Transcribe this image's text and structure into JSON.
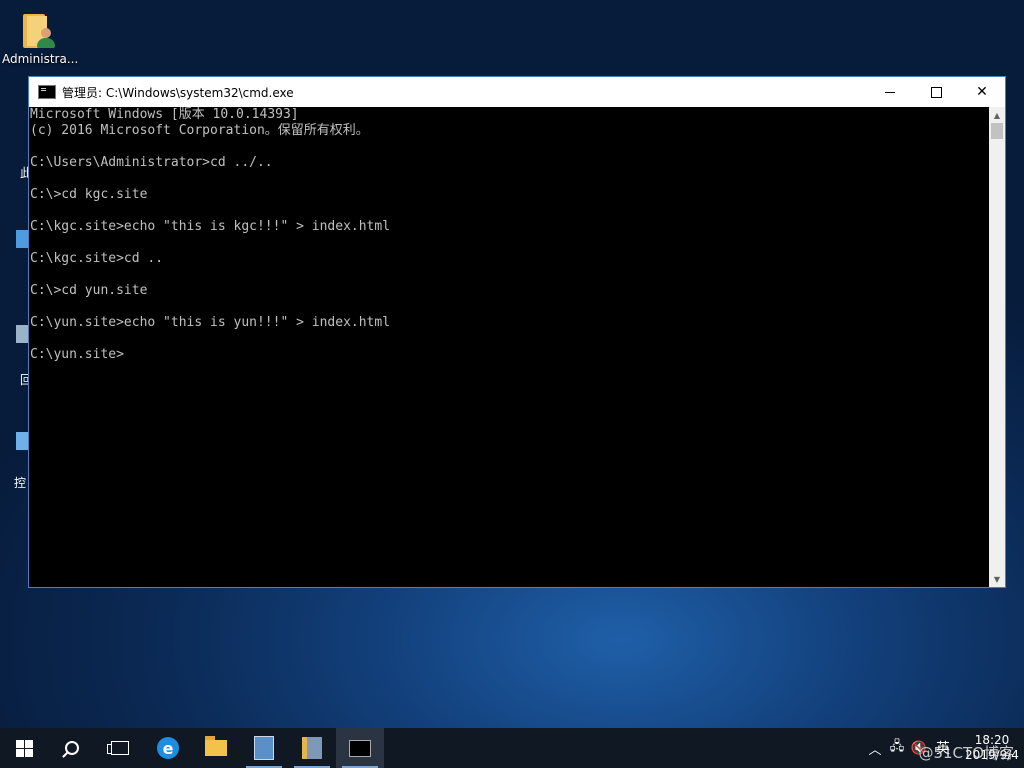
{
  "desktop": {
    "icons": [
      {
        "label": "Administra..."
      }
    ],
    "partial_labels": [
      "此",
      "回",
      "控"
    ]
  },
  "window": {
    "title": "管理员: C:\\Windows\\system32\\cmd.exe",
    "console_lines": [
      "Microsoft Windows [版本 10.0.14393]",
      "(c) 2016 Microsoft Corporation。保留所有权利。",
      "",
      "C:\\Users\\Administrator>cd ../..",
      "",
      "C:\\>cd kgc.site",
      "",
      "C:\\kgc.site>echo \"this is kgc!!!\" > index.html",
      "",
      "C:\\kgc.site>cd ..",
      "",
      "C:\\>cd yun.site",
      "",
      "C:\\yun.site>echo \"this is yun!!!\" > index.html",
      "",
      "C:\\yun.site>"
    ]
  },
  "taskbar": {
    "pinned": [
      {
        "name": "start"
      },
      {
        "name": "search"
      },
      {
        "name": "task-view"
      },
      {
        "name": "internet-explorer"
      },
      {
        "name": "file-explorer"
      },
      {
        "name": "server-manager"
      },
      {
        "name": "admin-tools"
      },
      {
        "name": "command-prompt",
        "active": true
      }
    ],
    "tray": {
      "ime": "英",
      "time": "18:20",
      "date": "2019/9/4"
    }
  },
  "watermark": "@51CTO博客"
}
